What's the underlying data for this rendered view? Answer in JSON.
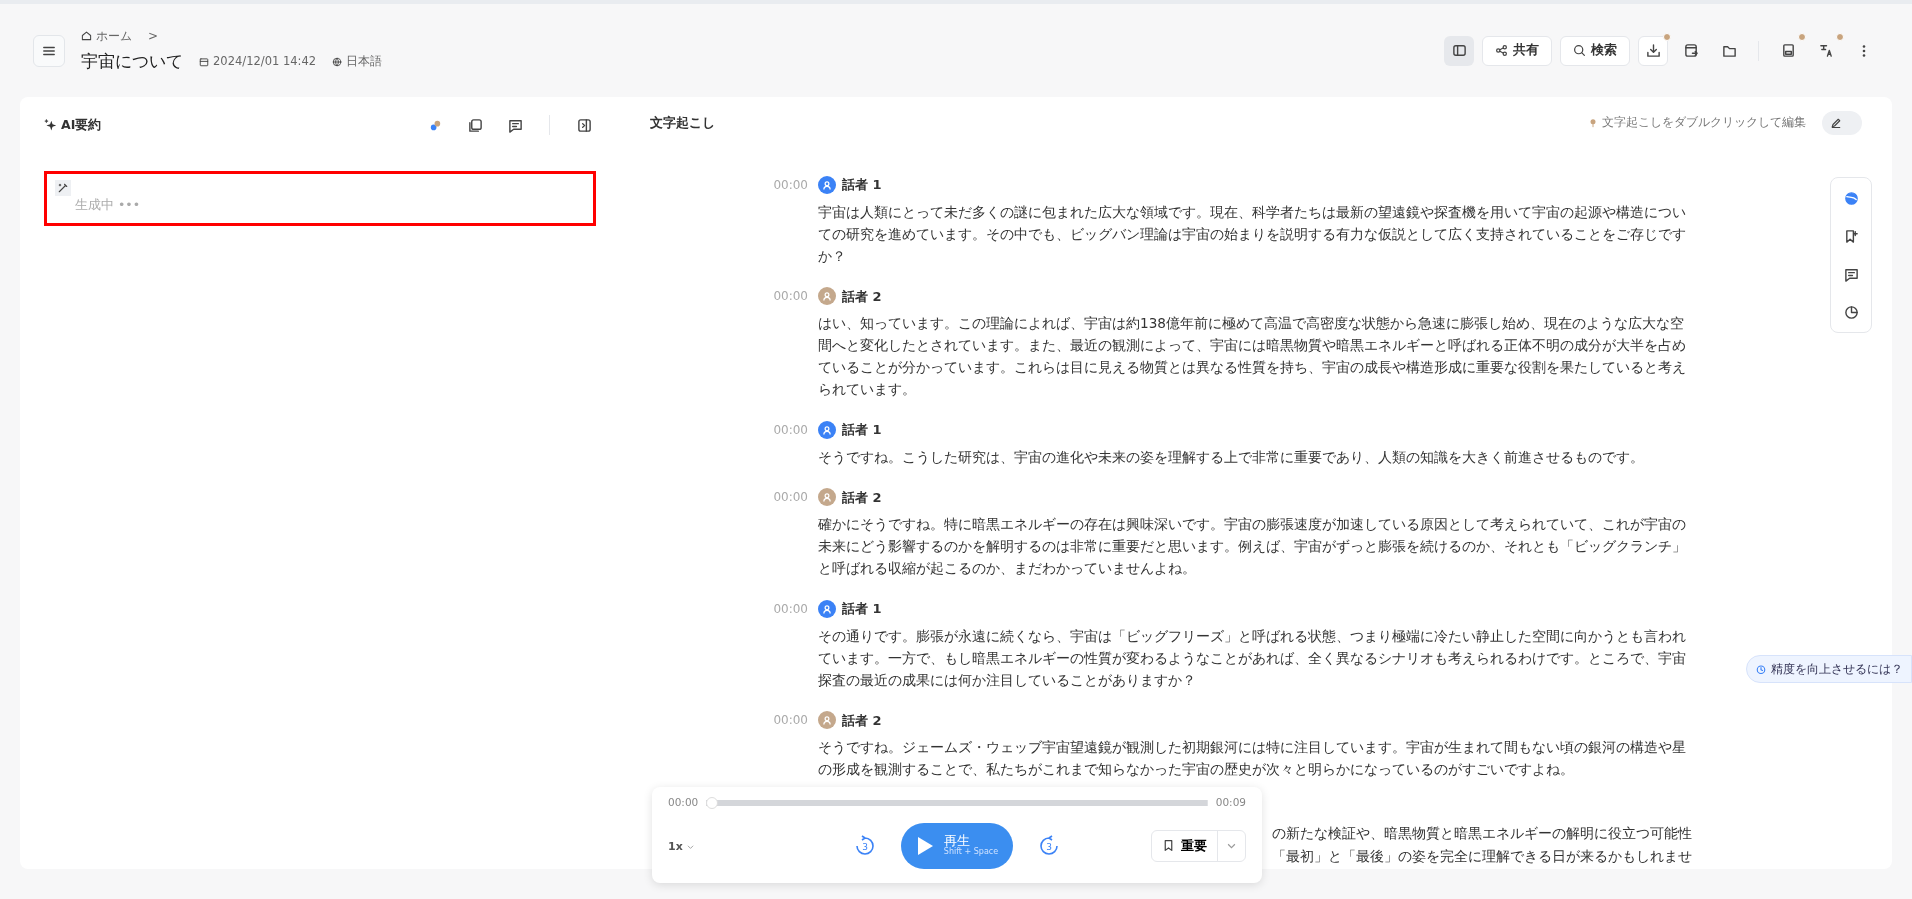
{
  "header": {
    "breadcrumb": "ホーム",
    "breadcrumb_sep": ">",
    "title": "宇宙について",
    "date": "2024/12/01 14:42",
    "language": "日本語"
  },
  "toolbar": [
    {
      "kind": "toggle",
      "selected": true
    },
    {
      "kind": "button",
      "label": "共有"
    },
    {
      "kind": "button",
      "label": "検索"
    },
    {
      "kind": "outlined",
      "dot": true
    },
    {
      "kind": "plain",
      "dot": false
    },
    {
      "kind": "plain",
      "dot": false
    },
    {
      "kind": "divider"
    },
    {
      "kind": "plain",
      "dot": true
    },
    {
      "kind": "plain",
      "dot": true
    },
    {
      "kind": "plain",
      "dot": false
    }
  ],
  "summary": {
    "title": "AI要約",
    "status": "生成中 •••",
    "highlighted": true
  },
  "transcript": {
    "title": "文字起こし",
    "hint": "文字起こしをダブルクリックして編集",
    "edit_on": false,
    "entries": [
      {
        "time": "00:00",
        "speaker": "話者 1",
        "color": "#3b82f6",
        "text": "宇宙は人類にとって未だ多くの謎に包まれた広大な領域です。現在、科学者たちは最新の望遠鏡や探査機を用いて宇宙の起源や構造についての研究を進めています。その中でも、ビッグバン理論は宇宙の始まりを説明する有力な仮説として広く支持されていることをご存じですか？"
      },
      {
        "time": "00:00",
        "speaker": "話者 2",
        "color": "#c4a88c",
        "text": "はい、知っています。この理論によれば、宇宙は約138億年前に極めて高温で高密度な状態から急速に膨張し始め、現在のような広大な空間へと変化したとされています。また、最近の観測によって、宇宙には暗黒物質や暗黒エネルギーと呼ばれる正体不明の成分が大半を占めていることが分かっています。これらは目に見える物質とは異なる性質を持ち、宇宙の成長や構造形成に重要な役割を果たしていると考えられています。"
      },
      {
        "time": "00:00",
        "speaker": "話者 1",
        "color": "#3b82f6",
        "text": "そうですね。こうした研究は、宇宙の進化や未来の姿を理解する上で非常に重要であり、人類の知識を大きく前進させるものです。"
      },
      {
        "time": "00:00",
        "speaker": "話者 2",
        "color": "#c4a88c",
        "text": "確かにそうですね。特に暗黒エネルギーの存在は興味深いです。宇宙の膨張速度が加速している原因として考えられていて、これが宇宙の未来にどう影響するのかを解明するのは非常に重要だと思います。例えば、宇宙がずっと膨張を続けるのか、それとも「ビッグクランチ」と呼ばれる収縮が起こるのか、まだわかっていませんよね。"
      },
      {
        "time": "00:00",
        "speaker": "話者 1",
        "color": "#3b82f6",
        "text": "その通りです。膨張が永遠に続くなら、宇宙は「ビッグフリーズ」と呼ばれる状態、つまり極端に冷たい静止した空間に向かうとも言われています。一方で、もし暗黒エネルギーの性質が変わるようなことがあれば、全く異なるシナリオも考えられるわけです。ところで、宇宙探査の最近の成果には何か注目していることがありますか？"
      },
      {
        "time": "00:00",
        "speaker": "話者 2",
        "color": "#c4a88c",
        "text": "そうですね。ジェームズ・ウェッブ宇宙望遠鏡が観測した初期銀河には特に注目しています。宇宙が生まれて間もない頃の銀河の構造や星の形成を観測することで、私たちがこれまで知らなかった宇宙の歴史が次々と明らかになっているのがすごいですよね。"
      }
    ],
    "partial_lines": [
      "の新たな検証や、暗黒物質と暗黒エネルギーの解明に役立つ可能性",
      "「最初」と「最後」の姿を完全に理解できる日が来るかもしれませ"
    ]
  },
  "accuracy_tip": "精度を向上させるには？",
  "player": {
    "current": "00:00",
    "total": "00:09",
    "level": 0.0,
    "speed": "1x",
    "rewind": "3",
    "forward": "3",
    "play_label": "再生",
    "play_hint": "Shift + Space",
    "bookmark": "重要"
  }
}
